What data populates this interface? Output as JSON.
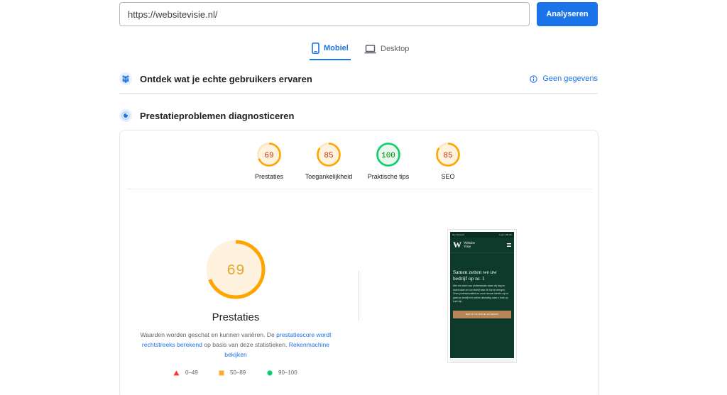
{
  "search": {
    "url": "https://websitevisie.nl/"
  },
  "actions": {
    "analyze_label": "Analyseren"
  },
  "tabs": [
    {
      "label": "Mobiel",
      "icon": "smartphone-icon",
      "active": true
    },
    {
      "label": "Desktop",
      "icon": "laptop-icon",
      "active": false
    }
  ],
  "field_data": {
    "title": "Ontdek wat je echte gebruikers ervaren",
    "status": "Geen gegevens",
    "icon": "users-icon",
    "status_icon": "info-icon"
  },
  "lab_data": {
    "title": "Prestatieproblemen diagnosticeren",
    "icon": "lab-icon"
  },
  "categories": [
    {
      "label": "Prestaties",
      "score": "69",
      "rating": "average"
    },
    {
      "label": "Toegankelijkheid",
      "score": "85",
      "rating": "average"
    },
    {
      "label": "Praktische tips",
      "score": "100",
      "rating": "pass"
    },
    {
      "label": "SEO",
      "score": "85",
      "rating": "average"
    }
  ],
  "main_score": {
    "score": "69",
    "title": "Prestaties",
    "desc_part1": "Waarden worden geschat en kunnen variëren. De ",
    "desc_link1": "prestatiescore wordt rechtstreeks berekend",
    "desc_part2": " op basis van deze statistieken. ",
    "desc_link2": "Rekenmachine bekijken"
  },
  "legend": [
    {
      "range": "0–49",
      "shape": "triangle",
      "color": "#ff3333"
    },
    {
      "range": "50–89",
      "shape": "square",
      "color": "#ffaa33"
    },
    {
      "range": "90–100",
      "shape": "circle",
      "color": "#0cce6b"
    }
  ],
  "colors": {
    "average": "#ffa400",
    "average_text": "#c33300",
    "average_bg": "#fff3e0",
    "pass": "#0cce6b",
    "pass_text": "#008800",
    "pass_bg": "#e8f8ef",
    "accent": "#1a73e8"
  },
  "screenshot": {
    "status_left": "Dev Network",
    "status_right": "Login  100  4G",
    "logo_mark": "W",
    "logo_text": "Website Visie",
    "headline": "Samen zetten we uw bedrijf op nr. 1",
    "body": "Met ons team van professionals staan wij dag en nacht klaar om uw bedrijf naar de top te brengen. Onze professionaliteit en onze nieuwe ideeën zijn er gaat uw bedrijf een online uitstraling waar u trots op kunt zijn.",
    "cta": "BEKIJK DE MOGELIJKHEDEN"
  }
}
